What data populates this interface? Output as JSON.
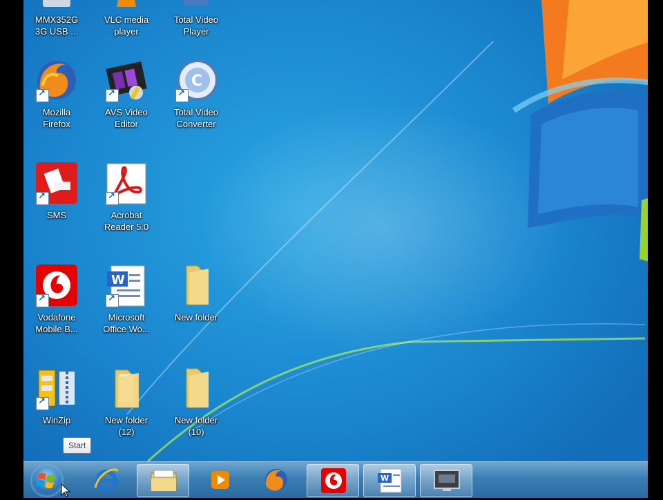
{
  "desktop": {
    "icons": [
      {
        "label": "MMX352G\n3G USB ..."
      },
      {
        "label": "VLC media\nplayer"
      },
      {
        "label": "Total Video\nPlayer"
      },
      {
        "label": "Mozilla\nFirefox"
      },
      {
        "label": "AVS Video\nEditor"
      },
      {
        "label": "Total Video\nConverter"
      },
      {
        "label": "SMS"
      },
      {
        "label": "Acrobat\nReader 5.0"
      },
      {
        "label": "Vodafone\nMobile B..."
      },
      {
        "label": "Microsoft\nOffice Wo..."
      },
      {
        "label": "New folder"
      },
      {
        "label": "WinZip"
      },
      {
        "label": "New folder\n(12)"
      },
      {
        "label": "New folder\n(10)"
      }
    ]
  },
  "tooltip": {
    "text": "Start"
  },
  "taskbar": {
    "items": [
      {
        "icon": "internet-explorer-icon"
      },
      {
        "icon": "windows-explorer-icon"
      },
      {
        "icon": "media-player-icon"
      },
      {
        "icon": "firefox-icon"
      },
      {
        "icon": "vodafone-icon"
      },
      {
        "icon": "word-icon"
      },
      {
        "icon": "camrec-icon"
      }
    ]
  },
  "colors": {
    "accent": "#2aa6e2",
    "vodafone": "#e60000",
    "folder": "#e8c96a"
  }
}
